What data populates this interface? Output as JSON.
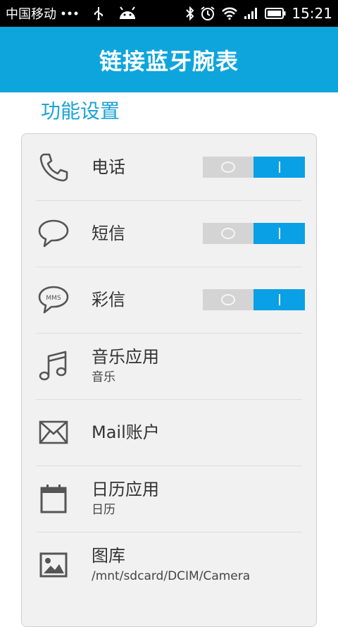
{
  "status_bar": {
    "carrier": "中国移动",
    "time": "15:21"
  },
  "title_bar": {
    "title": "链接蓝牙腕表"
  },
  "section": {
    "title": "功能设置"
  },
  "settings": [
    {
      "label": "电话",
      "icon": "phone-icon",
      "toggle": true
    },
    {
      "label": "短信",
      "icon": "sms-bubble-icon",
      "toggle": true
    },
    {
      "label": "彩信",
      "icon": "mms-bubble-icon",
      "icon_text": "MMS",
      "toggle": true
    },
    {
      "label": "音乐应用",
      "sub": "音乐",
      "icon": "music-note-icon"
    },
    {
      "label": "Mail账户",
      "icon": "mail-envelope-icon"
    },
    {
      "label": "日历应用",
      "sub": "日历",
      "icon": "calendar-icon"
    },
    {
      "label": "图库",
      "sub": "/mnt/sdcard/DCIM/Camera",
      "icon": "gallery-image-icon"
    }
  ],
  "colors": {
    "accent": "#0ea5dc",
    "section_title": "#1aa3d6",
    "toggle_on": "#0aa0e6",
    "toggle_off": "#d4d4d4"
  }
}
